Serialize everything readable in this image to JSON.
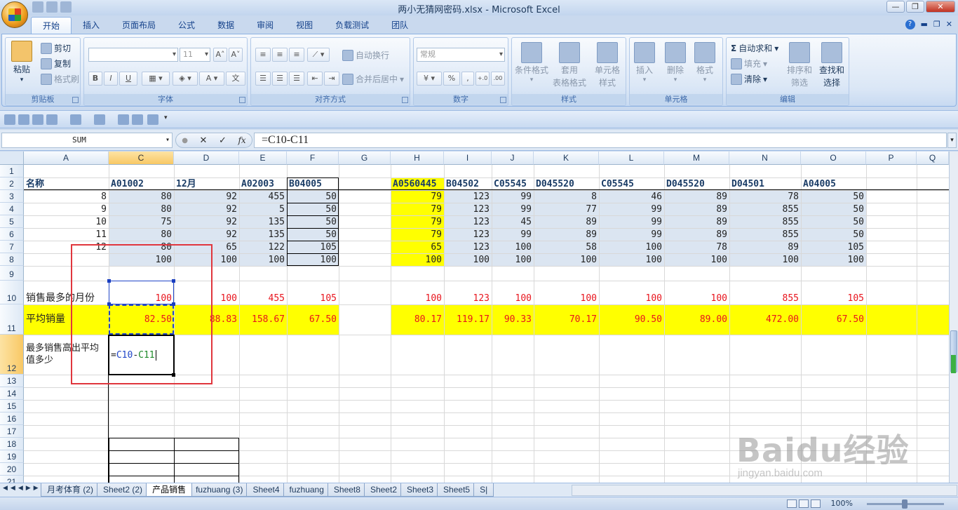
{
  "window": {
    "title": "两小无猜网密码.xlsx - Microsoft Excel"
  },
  "ribbon_tabs": [
    "开始",
    "插入",
    "页面布局",
    "公式",
    "数据",
    "审阅",
    "视图",
    "负载测试",
    "团队"
  ],
  "ribbon": {
    "clipboard": {
      "label": "剪贴板",
      "paste": "粘贴",
      "cut": "剪切",
      "copy": "复制",
      "format_painter": "格式刷"
    },
    "font": {
      "label": "字体",
      "size": "11",
      "bold": "B",
      "italic": "I",
      "underline": "U",
      "grow": "A˄",
      "shrink": "A˅"
    },
    "alignment": {
      "label": "对齐方式",
      "wrap": "自动换行",
      "merge": "合并后居中"
    },
    "number": {
      "label": "数字",
      "format": "常规",
      "percent": "%",
      "comma": ",",
      "inc": "+.0",
      "dec": ".00"
    },
    "styles": {
      "label": "样式",
      "conditional": "条件格式",
      "table_format_1": "套用",
      "table_format_2": "表格格式",
      "cell_style_1": "单元格",
      "cell_style_2": "样式"
    },
    "cells": {
      "label": "单元格",
      "insert": "插入",
      "delete": "删除",
      "format": "格式"
    },
    "editing": {
      "label": "编辑",
      "autosum": "自动求和",
      "fill": "填充",
      "clear": "清除",
      "sort_1": "排序和",
      "sort_2": "筛选",
      "find_1": "查找和",
      "find_2": "选择"
    }
  },
  "formula_bar": {
    "name_box": "SUM",
    "cancel": "✕",
    "enter": "✓",
    "fx": "fx",
    "formula": "=C10-C11"
  },
  "columns": [
    "A",
    "C",
    "D",
    "E",
    "F",
    "G",
    "H",
    "I",
    "J",
    "K",
    "L",
    "M",
    "N",
    "O",
    "P",
    "Q"
  ],
  "rows": [
    "1",
    "2",
    "3",
    "4",
    "5",
    "6",
    "7",
    "8",
    "9",
    "10",
    "11",
    "12",
    "13",
    "14",
    "15",
    "16",
    "17",
    "18",
    "19",
    "20",
    "21"
  ],
  "sheet": {
    "row2": [
      "名称",
      "A01002",
      "12月",
      "A02003",
      "B04005",
      "",
      "A0560445",
      "B04502",
      "C05545",
      "D045520",
      "C05545",
      "D045520",
      "D04501",
      "A04005"
    ],
    "row3": [
      "8",
      "80",
      "92",
      "455",
      "50",
      "",
      "79",
      "123",
      "99",
      "8",
      "46",
      "89",
      "78",
      "50"
    ],
    "row4": [
      "9",
      "80",
      "92",
      "5",
      "50",
      "",
      "79",
      "123",
      "99",
      "77",
      "99",
      "89",
      "855",
      "50"
    ],
    "row5": [
      "10",
      "75",
      "92",
      "135",
      "50",
      "",
      "79",
      "123",
      "45",
      "89",
      "99",
      "89",
      "855",
      "50"
    ],
    "row6": [
      "11",
      "80",
      "92",
      "135",
      "50",
      "",
      "79",
      "123",
      "99",
      "89",
      "99",
      "89",
      "855",
      "50"
    ],
    "row7": [
      "12",
      "80",
      "65",
      "122",
      "105",
      "",
      "65",
      "123",
      "100",
      "58",
      "100",
      "78",
      "89",
      "105"
    ],
    "row8": [
      "",
      "100",
      "100",
      "100",
      "100",
      "",
      "100",
      "100",
      "100",
      "100",
      "100",
      "100",
      "100",
      "100"
    ],
    "row10": [
      "销售最多的月份",
      "100",
      "100",
      "455",
      "105",
      "",
      "100",
      "123",
      "100",
      "100",
      "100",
      "100",
      "855",
      "105"
    ],
    "row11": [
      "平均销量",
      "82.50",
      "88.83",
      "158.67",
      "67.50",
      "",
      "80.17",
      "119.17",
      "90.33",
      "70.17",
      "90.50",
      "89.00",
      "472.00",
      "67.50"
    ],
    "row12_label": "最多销售高出平均值多少",
    "row12_edit": {
      "eq": "=",
      "ref1": "C10",
      "op": "-",
      "ref2": "C11"
    }
  },
  "sheet_tabs": [
    "月考体育 (2)",
    "Sheet2 (2)",
    "产品销售",
    "fuzhuang (3)",
    "Sheet4",
    "fuzhuang",
    "Sheet8",
    "Sheet2",
    "Sheet3",
    "Sheet5",
    "S|"
  ],
  "active_sheet": "产品销售",
  "status": {
    "zoom": "100%"
  },
  "watermark": {
    "brand": "Baidu经验",
    "url": "jingyan.baidu.com"
  },
  "colors": {
    "accent": "#15428b",
    "highlight_yellow": "#ffff00",
    "value_red": "#e8141d",
    "annotation_red": "#e0363d"
  }
}
